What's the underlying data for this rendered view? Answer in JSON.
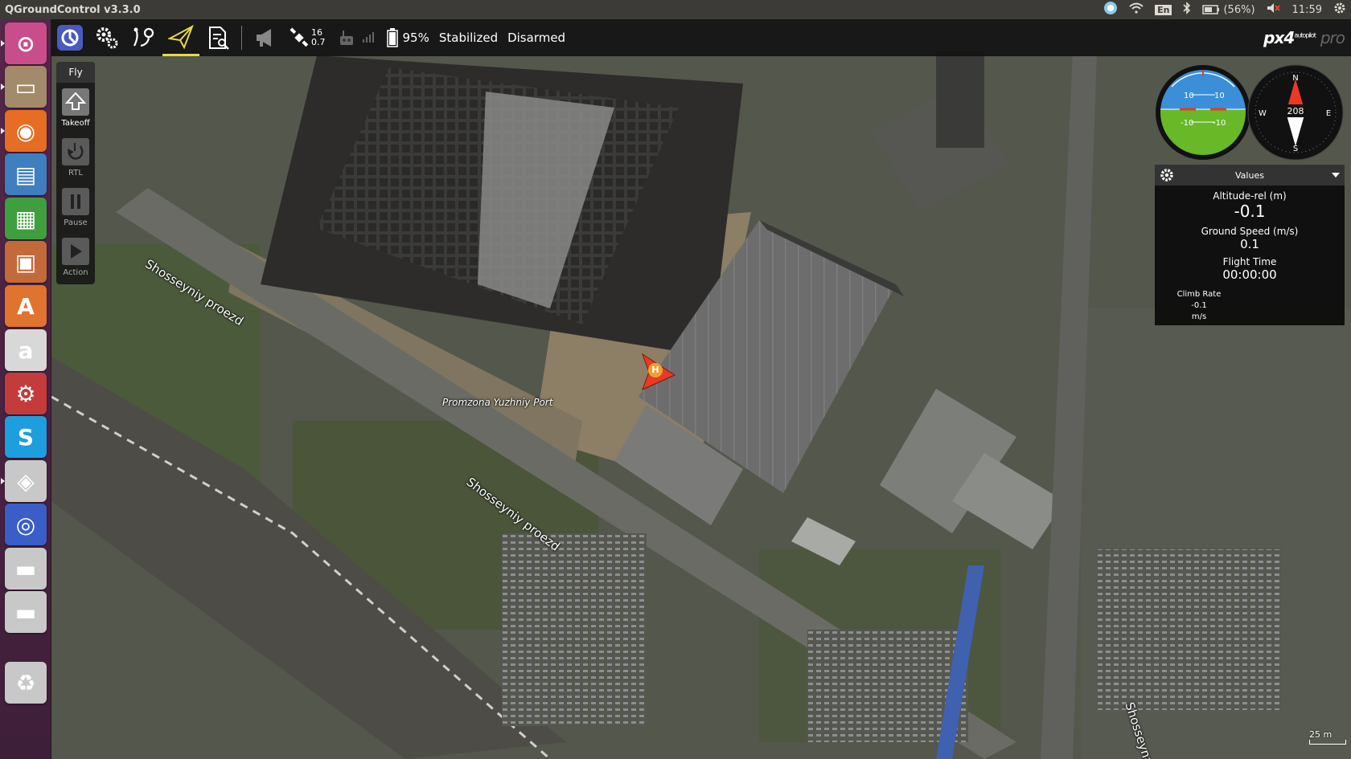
{
  "os": {
    "window_title": "QGroundControl v3.3.0",
    "keyboard_layout": "En",
    "battery": "(56%)",
    "clock": "11:59",
    "icons": [
      "qgc-tray-icon",
      "wifi-icon",
      "keyboard-icon",
      "bluetooth-icon",
      "battery-icon",
      "volume-muted-icon",
      "settings-gear-icon"
    ]
  },
  "launcher": {
    "items": [
      {
        "name": "ubuntu-dash",
        "glyph": "⊙",
        "color": "#c94d8a"
      },
      {
        "name": "files",
        "glyph": "▭",
        "color": "#a38a6a"
      },
      {
        "name": "firefox",
        "glyph": "◉",
        "color": "#e66d23"
      },
      {
        "name": "libreoffice-writer",
        "glyph": "▤",
        "color": "#3f7fbf"
      },
      {
        "name": "libreoffice-calc",
        "glyph": "▦",
        "color": "#3f9f3f"
      },
      {
        "name": "libreoffice-impress",
        "glyph": "▣",
        "color": "#c46a3a"
      },
      {
        "name": "software-center",
        "glyph": "A",
        "color": "#e0742e"
      },
      {
        "name": "amazon",
        "glyph": "a",
        "color": "#d8d8d8"
      },
      {
        "name": "system-settings",
        "glyph": "⚙",
        "color": "#c43b3b"
      },
      {
        "name": "skype",
        "glyph": "S",
        "color": "#1e9ede"
      },
      {
        "name": "security",
        "glyph": "◈",
        "color": "#c8c8c8"
      },
      {
        "name": "qgroundcontrol",
        "glyph": "◎",
        "color": "#3a5ec8"
      },
      {
        "name": "disk-1",
        "glyph": "▬",
        "color": "#c8c8c8"
      },
      {
        "name": "disk-2",
        "glyph": "▬",
        "color": "#c8c8c8"
      },
      {
        "name": "trash",
        "glyph": "♻",
        "color": "#c8c8c8"
      }
    ]
  },
  "toolbar": {
    "satellite_count": "16",
    "hdop": "0.7",
    "battery_percent": "95%",
    "flight_mode": "Stabilized",
    "arm_state": "Disarmed",
    "logo_main": "px4",
    "logo_sub": "autopilot",
    "logo_pro": "pro"
  },
  "flytools": {
    "header": "Fly",
    "buttons": [
      {
        "label": "Takeoff",
        "icon": "takeoff-icon"
      },
      {
        "label": "RTL",
        "icon": "rtl-icon"
      },
      {
        "label": "Pause",
        "icon": "pause-icon"
      },
      {
        "label": "Action",
        "icon": "action-icon"
      }
    ]
  },
  "attitude": {
    "ticks": [
      "10",
      "10",
      "-10",
      "-10"
    ]
  },
  "compass": {
    "heading": "208",
    "n": "N",
    "e": "E",
    "s": "S",
    "w": "W"
  },
  "values": {
    "header": "Values",
    "altitude_label": "Altitude-rel (m)",
    "altitude": "-0.1",
    "speed_label": "Ground Speed (m/s)",
    "speed": "0.1",
    "flight_time_label": "Flight Time",
    "flight_time": "00:00:00",
    "climb_label": "Climb Rate",
    "climb_value": "-0.1",
    "climb_unit": "m/s"
  },
  "map": {
    "labels": {
      "road1": "Shosseyniy proezd",
      "road2": "Shosseyniy proezd",
      "area": "Promzona Yuzhniy Port",
      "road3": "Shosseynaya"
    },
    "home_marker": "H",
    "scale": "25 m"
  }
}
